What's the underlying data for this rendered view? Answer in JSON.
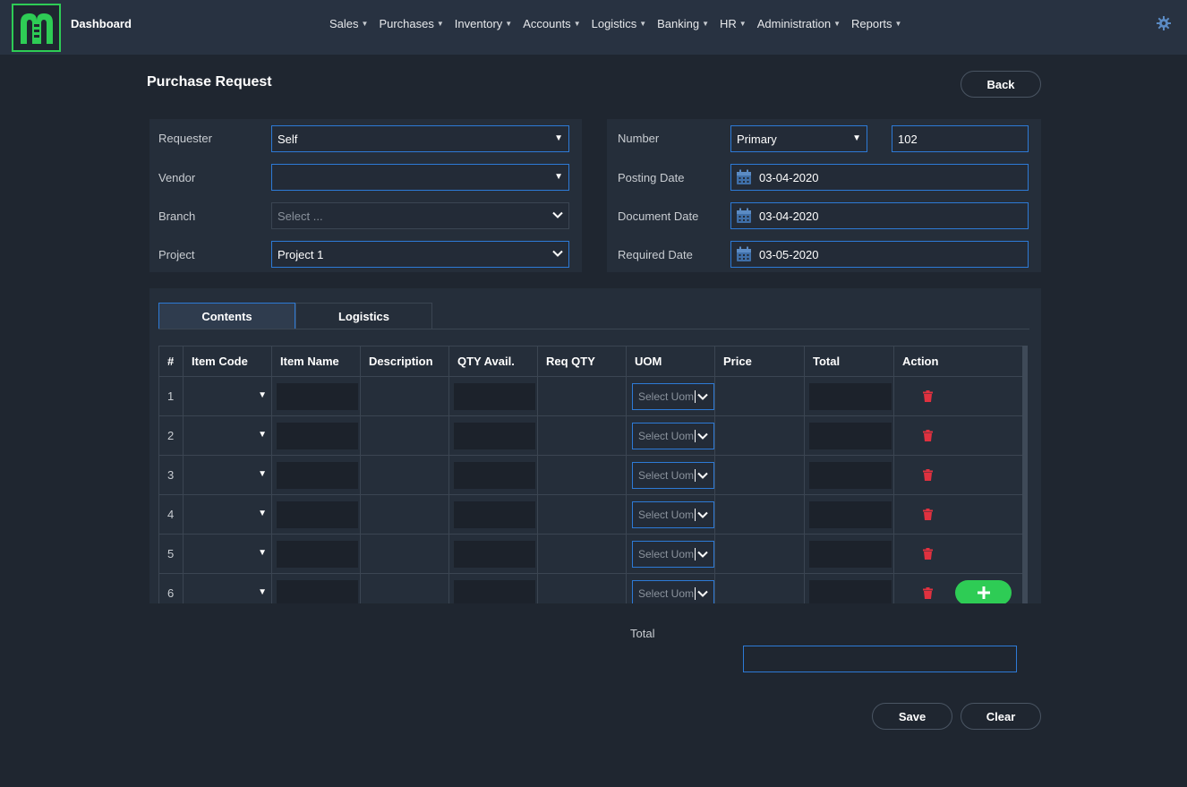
{
  "header": {
    "dashboard_label": "Dashboard",
    "nav": [
      "Sales",
      "Purchases",
      "Inventory",
      "Accounts",
      "Logistics",
      "Banking",
      "HR",
      "Administration",
      "Reports"
    ]
  },
  "page": {
    "title": "Purchase Request",
    "back_label": "Back"
  },
  "form_left": {
    "requester_label": "Requester",
    "requester_value": "Self",
    "vendor_label": "Vendor",
    "vendor_value": "",
    "branch_label": "Branch",
    "branch_placeholder": "Select ...",
    "project_label": "Project",
    "project_value": "Project 1"
  },
  "form_right": {
    "number_label": "Number",
    "number_series": "Primary",
    "number_value": "102",
    "posting_label": "Posting Date",
    "posting_value": "03-04-2020",
    "document_label": "Document Date",
    "document_value": "03-04-2020",
    "required_label": "Required Date",
    "required_value": "03-05-2020"
  },
  "tabs": [
    "Contents",
    "Logistics"
  ],
  "table": {
    "columns": [
      "#",
      "Item Code",
      "Item Name",
      "Description",
      "QTY Avail.",
      "Req QTY",
      "UOM",
      "Price",
      "Total",
      "Action"
    ],
    "rows": [
      "1",
      "2",
      "3",
      "4",
      "5",
      "6"
    ],
    "uom_placeholder": "Select Uom"
  },
  "totals": {
    "label": "Total",
    "value": ""
  },
  "actions": {
    "save_label": "Save",
    "clear_label": "Clear"
  },
  "colors": {
    "accent_blue": "#2d7ad6",
    "brand_green": "#2ecc55",
    "danger_red": "#e0313f"
  }
}
